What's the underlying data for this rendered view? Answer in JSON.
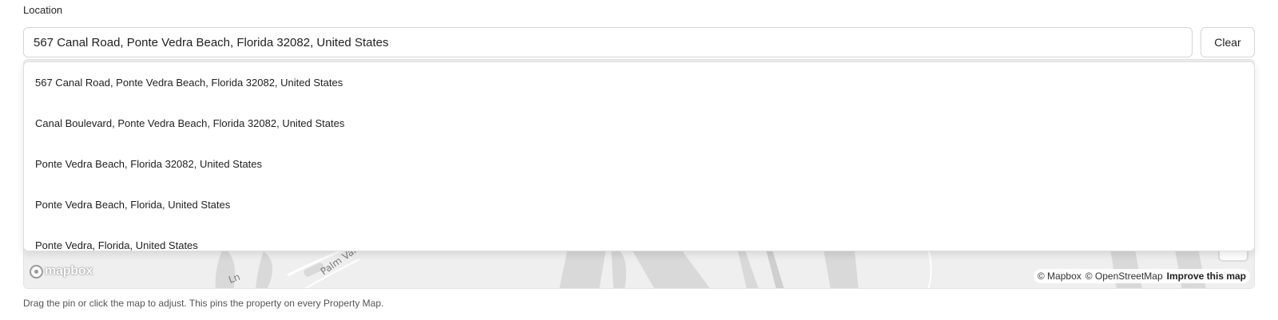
{
  "location": {
    "label": "Location",
    "value": "567 Canal Road, Ponte Vedra Beach, Florida 32082, United States",
    "clear_label": "Clear"
  },
  "suggestions": [
    {
      "text": "567 Canal Road, Ponte Vedra Beach, Florida 32082, United States"
    },
    {
      "text": "Canal Boulevard, Ponte Vedra Beach, Florida 32082, United States"
    },
    {
      "text": "Ponte Vedra Beach, Florida 32082, United States"
    },
    {
      "text": "Ponte Vedra Beach, Florida, United States"
    },
    {
      "text": "Ponte Vedra, Florida, United States"
    }
  ],
  "map": {
    "road_labels": [
      "Palm Valley",
      "Ln"
    ],
    "logo_text": "mapbox",
    "attribution": {
      "mapbox": "© Mapbox",
      "osm": "© OpenStreetMap",
      "improve": "Improve this map"
    },
    "zoom_out_symbol": "−"
  },
  "helper_text": "Drag the pin or click the map to adjust. This pins the property on every Property Map.",
  "colors": {
    "map_background": "#efefef",
    "map_feature": "#d9d9d9",
    "border": "#d6d6d6"
  }
}
